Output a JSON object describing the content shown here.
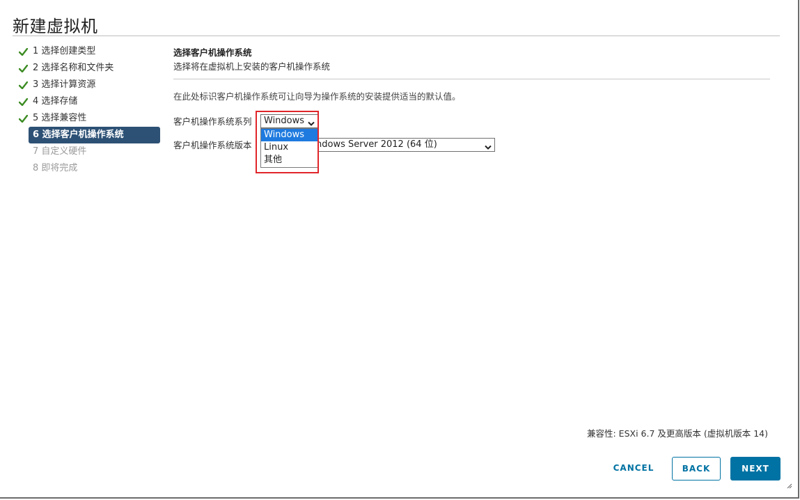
{
  "window": {
    "title": "新建虚拟机"
  },
  "steps": [
    {
      "label": "1 选择创建类型",
      "state": "done"
    },
    {
      "label": "2 选择名称和文件夹",
      "state": "done"
    },
    {
      "label": "3 选择计算资源",
      "state": "done"
    },
    {
      "label": "4 选择存储",
      "state": "done"
    },
    {
      "label": "5 选择兼容性",
      "state": "done"
    },
    {
      "label": "6 选择客户机操作系统",
      "state": "active"
    },
    {
      "label": "7 自定义硬件",
      "state": "pending"
    },
    {
      "label": "8 即将完成",
      "state": "pending"
    }
  ],
  "main": {
    "title": "选择客户机操作系统",
    "subtitle": "选择将在虚拟机上安装的客户机操作系统",
    "description": "在此处标识客户机操作系统可让向导为操作系统的安装提供适当的默认值。",
    "family_label": "客户机操作系统系列",
    "family_value": "Windows",
    "family_options": [
      "Windows",
      "Linux",
      "其他"
    ],
    "version_label": "客户机操作系统版本",
    "version_value_visible": "ndows Server 2012 (64 位)"
  },
  "footer": {
    "compatibility": "兼容性: ESXi 6.7 及更高版本 (虚拟机版本 14)",
    "cancel_label": "CANCEL",
    "back_label": "BACK",
    "next_label": "NEXT"
  },
  "colors": {
    "check": "#3c8c23",
    "active_step_bg": "#2d5175",
    "highlight_border": "#e0252a",
    "primary": "#0072a3",
    "selected_option": "#1e7adf"
  },
  "icons": {
    "step_done": "checkmark-icon",
    "select_arrow": "chevron-down-icon",
    "resize": "resize-grip-icon"
  }
}
